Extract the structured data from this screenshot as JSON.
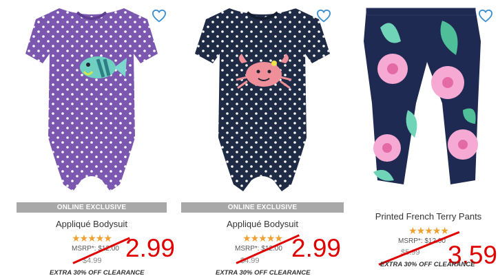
{
  "products": [
    {
      "image_icon": "purple-fish-bodysuit",
      "badge": "ONLINE EXCLUSIVE",
      "name": "Appliqué Bodysuit",
      "rating": 5,
      "stars": "★★★★★",
      "msrp_label": "MSRP*: $12.00",
      "old_price": "$4.99",
      "new_price": "2.99",
      "clearance_note": "EXTRA 30% OFF CLEARANCE"
    },
    {
      "image_icon": "navy-crab-bodysuit",
      "badge": "ONLINE EXCLUSIVE",
      "name": "Appliqué Bodysuit",
      "rating": 5,
      "stars": "★★★★★",
      "msrp_label": "MSRP*: $12.00",
      "old_price": "$4.99",
      "new_price": "2.99",
      "clearance_note": "EXTRA 30% OFF CLEARANCE"
    },
    {
      "image_icon": "floral-french-terry-pants",
      "badge": "",
      "name": "Printed French Terry Pants",
      "rating": 5,
      "stars": "★★★★★",
      "msrp_label": "MSRP*: $12.00",
      "old_price": "$5.99",
      "new_price": "3.59",
      "clearance_note": "EXTRA 30% OFF CLEARANCE"
    }
  ],
  "colors": {
    "accent_blue": "#3a8fd0",
    "star_orange": "#f0a030",
    "markup_red": "#e00000",
    "badge_gray": "#a8a8a8",
    "purple_fabric": "#7b57b0",
    "navy_fabric": "#1f2a44"
  }
}
